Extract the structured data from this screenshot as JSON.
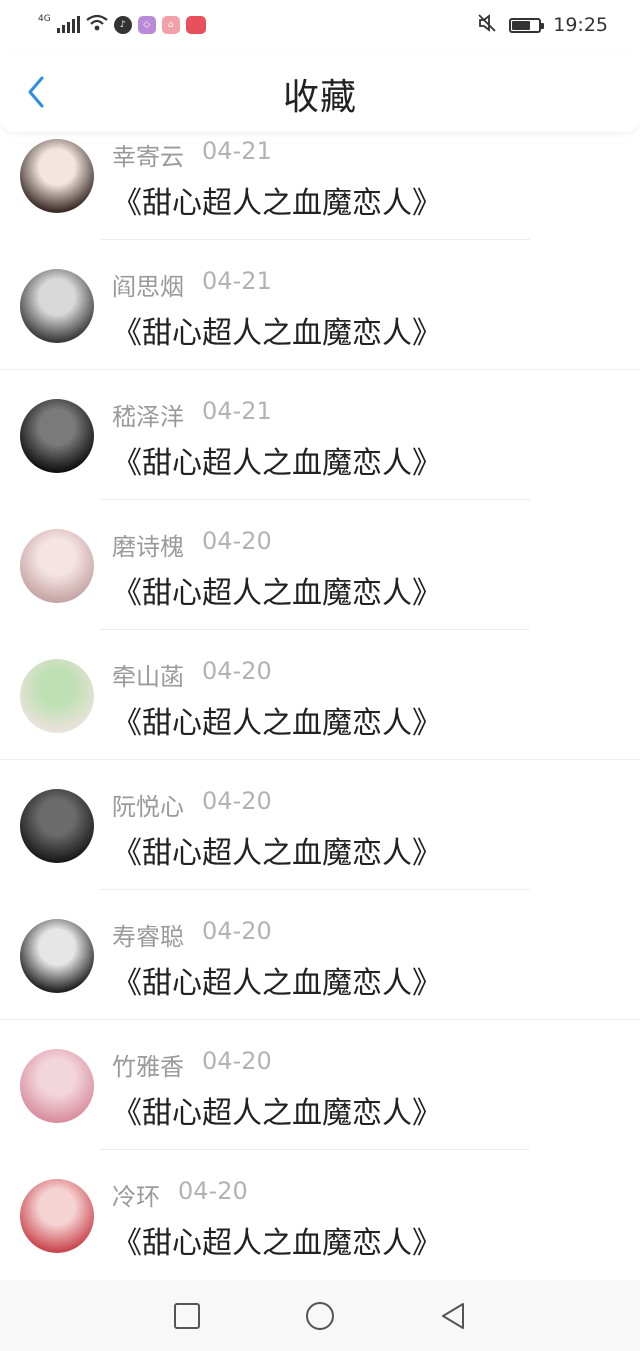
{
  "status_bar": {
    "network": "4G",
    "time": "19:25",
    "app_icons": [
      {
        "name": "tiktok-icon",
        "color": "#333333",
        "glyph": "♪"
      },
      {
        "name": "app-purple-icon",
        "color": "#b98ad8",
        "glyph": "◇"
      },
      {
        "name": "app-pink-icon",
        "color": "#f2a0a8",
        "glyph": "⌂"
      },
      {
        "name": "app-red-icon",
        "color": "#e8505b",
        "glyph": ""
      }
    ]
  },
  "header": {
    "title": "收藏"
  },
  "accent_color": "#1e88e5",
  "items": [
    {
      "name": "幸寄云",
      "date": "04-21",
      "title": "《甜心超人之血魔恋人》",
      "avatar": [
        "#f2e6df",
        "#3b2c27"
      ],
      "divider": "inset"
    },
    {
      "name": "阎思烟",
      "date": "04-21",
      "title": "《甜心超人之血魔恋人》",
      "avatar": [
        "#d9d9d9",
        "#3a3a3a"
      ],
      "divider": "full"
    },
    {
      "name": "嵇泽洋",
      "date": "04-21",
      "title": "《甜心超人之血魔恋人》",
      "avatar": [
        "#7a7a7a",
        "#111111"
      ],
      "divider": "inset"
    },
    {
      "name": "磨诗槐",
      "date": "04-20",
      "title": "《甜心超人之血魔恋人》",
      "avatar": [
        "#f6e4e4",
        "#c7a5a5"
      ],
      "divider": "inset"
    },
    {
      "name": "牵山菡",
      "date": "04-20",
      "title": "《甜心超人之血魔恋人》",
      "avatar": [
        "#bfe0b5",
        "#e9e2d9"
      ],
      "divider": "full"
    },
    {
      "name": "阮悦心",
      "date": "04-20",
      "title": "《甜心超人之血魔恋人》",
      "avatar": [
        "#6b6b6b",
        "#1a1a1a"
      ],
      "divider": "inset"
    },
    {
      "name": "寿睿聪",
      "date": "04-20",
      "title": "《甜心超人之血魔恋人》",
      "avatar": [
        "#e6e6e6",
        "#222222"
      ],
      "divider": "full"
    },
    {
      "name": "竹雅香",
      "date": "04-20",
      "title": "《甜心超人之血魔恋人》",
      "avatar": [
        "#f3d6dc",
        "#d98ea0"
      ],
      "divider": "inset"
    },
    {
      "name": "冷环",
      "date": "04-20",
      "title": "《甜心超人之血魔恋人》",
      "avatar": [
        "#f6d3d3",
        "#c9484f"
      ],
      "divider": "none"
    }
  ]
}
